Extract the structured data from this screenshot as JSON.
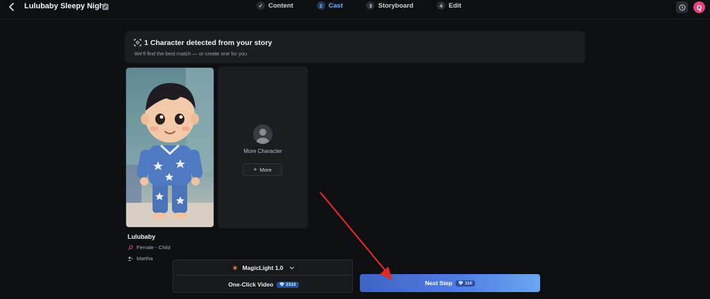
{
  "header": {
    "title": "Lulubaby Sleepy Night",
    "steps": [
      {
        "num": "✓",
        "label": "Content"
      },
      {
        "num": "2",
        "label": "Cast"
      },
      {
        "num": "3",
        "label": "Storyboard"
      },
      {
        "num": "4",
        "label": "Edit"
      }
    ],
    "active_step": "Cast",
    "avatar_initial": "Q"
  },
  "banner": {
    "title": "1 Character detected from your story",
    "subtitle": "We'll find the best match — or create one for you"
  },
  "character": {
    "name": "Lulubaby",
    "gender": "Female - Child",
    "voice": "Martha"
  },
  "more_card": {
    "label": "More Character",
    "button": "More"
  },
  "bottom": {
    "model": "MagicLight 1.0",
    "one_click_label": "One-Click Video",
    "one_click_cost": "2310",
    "next_label": "Next Step",
    "next_cost": "110"
  },
  "colors": {
    "accent": "#4f7ee0",
    "active_step": "#6fb4ff",
    "avatar": "#e0457b",
    "annotation_arrow": "#e02828"
  }
}
